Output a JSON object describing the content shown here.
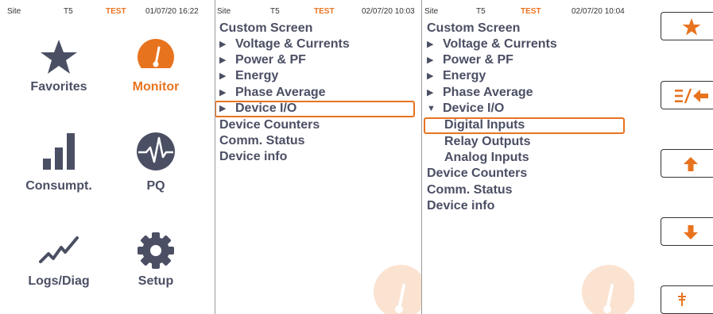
{
  "colors": {
    "accent": "#e8731f",
    "icon_gray": "#4b4f64",
    "text": "#4b4f64"
  },
  "screen1": {
    "status": {
      "site": "Site",
      "device": "T5",
      "mode": "TEST",
      "datetime": "01/07/20 16:22"
    },
    "tiles": [
      {
        "label": "Favorites",
        "icon": "star-icon",
        "active": false
      },
      {
        "label": "Monitor",
        "icon": "gauge-icon",
        "active": true
      },
      {
        "label": "Consumpt.",
        "icon": "bar-chart-icon",
        "active": false
      },
      {
        "label": "PQ",
        "icon": "waveform-icon",
        "active": false
      },
      {
        "label": "Logs/Diag",
        "icon": "trend-line-icon",
        "active": false
      },
      {
        "label": "Setup",
        "icon": "gear-icon",
        "active": false
      }
    ]
  },
  "screen2": {
    "status": {
      "site": "Site",
      "device": "T5",
      "mode": "TEST",
      "datetime": "02/07/20 10:03"
    },
    "menu": [
      {
        "label": "Custom Screen",
        "arrow": ""
      },
      {
        "label": "Voltage & Currents",
        "arrow": "▶"
      },
      {
        "label": "Power & PF",
        "arrow": "▶"
      },
      {
        "label": "Energy",
        "arrow": "▶"
      },
      {
        "label": "Phase Average",
        "arrow": "▶"
      },
      {
        "label": "Device I/O",
        "arrow": "▶",
        "selected": true
      },
      {
        "label": "Device Counters",
        "arrow": ""
      },
      {
        "label": "Comm. Status",
        "arrow": ""
      },
      {
        "label": "Device info",
        "arrow": ""
      }
    ]
  },
  "screen3": {
    "status": {
      "site": "Site",
      "device": "T5",
      "mode": "TEST",
      "datetime": "02/07/20 10:04"
    },
    "menu": [
      {
        "label": "Custom Screen",
        "arrow": ""
      },
      {
        "label": "Voltage & Currents",
        "arrow": "▶"
      },
      {
        "label": "Power & PF",
        "arrow": "▶"
      },
      {
        "label": "Energy",
        "arrow": "▶"
      },
      {
        "label": "Phase Average",
        "arrow": "▶"
      },
      {
        "label": "Device I/O",
        "arrow": "▼"
      },
      {
        "label": "Digital Inputs",
        "arrow": "",
        "sub": true,
        "selected": true
      },
      {
        "label": "Relay Outputs",
        "arrow": "",
        "sub": true
      },
      {
        "label": "Analog Inputs",
        "arrow": "",
        "sub": true
      },
      {
        "label": "Device Counters",
        "arrow": ""
      },
      {
        "label": "Comm. Status",
        "arrow": ""
      },
      {
        "label": "Device info",
        "arrow": ""
      }
    ]
  },
  "side_buttons": [
    {
      "icon": "star-icon"
    },
    {
      "icon": "menu-back-icon"
    },
    {
      "icon": "arrow-up-icon"
    },
    {
      "icon": "arrow-down-icon"
    },
    {
      "icon": "enter-icon"
    }
  ]
}
